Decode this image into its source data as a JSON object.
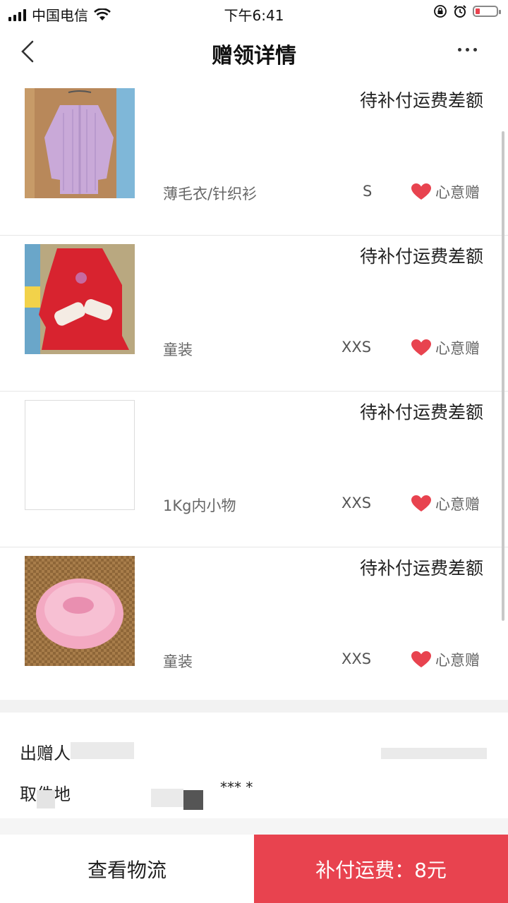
{
  "status_bar": {
    "carrier": "中国电信",
    "time": "下午6:41",
    "battery_level": 0.15,
    "battery_color": "#e8434f"
  },
  "nav": {
    "title": "赠领详情"
  },
  "items": [
    {
      "status": "待补付运费差额",
      "category": "薄毛衣/针织衫",
      "size": "S",
      "gift_label": "心意赠",
      "image": "purple-cardigan"
    },
    {
      "status": "待补付运费差额",
      "category": "童装",
      "size": "XXS",
      "gift_label": "心意赠",
      "image": "red-kids-dress"
    },
    {
      "status": "待补付运费差额",
      "category": "1Kg内小物",
      "size": "XXS",
      "gift_label": "心意赠",
      "image": "blank"
    },
    {
      "status": "待补付运费差额",
      "category": "童装",
      "size": "XXS",
      "gift_label": "心意赠",
      "image": "pink-tutu-skirt"
    }
  ],
  "info": {
    "donor_label": "出赠人",
    "pickup_label": "取件地",
    "pickup_masked": "***   *"
  },
  "bottom": {
    "logistics_label": "查看物流",
    "pay_label": "补付运费：8元"
  },
  "colors": {
    "accent": "#e8434f",
    "heart": "#e8434f"
  },
  "icons": {
    "back": "chevron-left-icon",
    "more": "more-icon",
    "heart": "heart-icon",
    "wifi": "wifi-icon",
    "alarm": "alarm-icon",
    "lock": "orientation-lock-icon"
  }
}
